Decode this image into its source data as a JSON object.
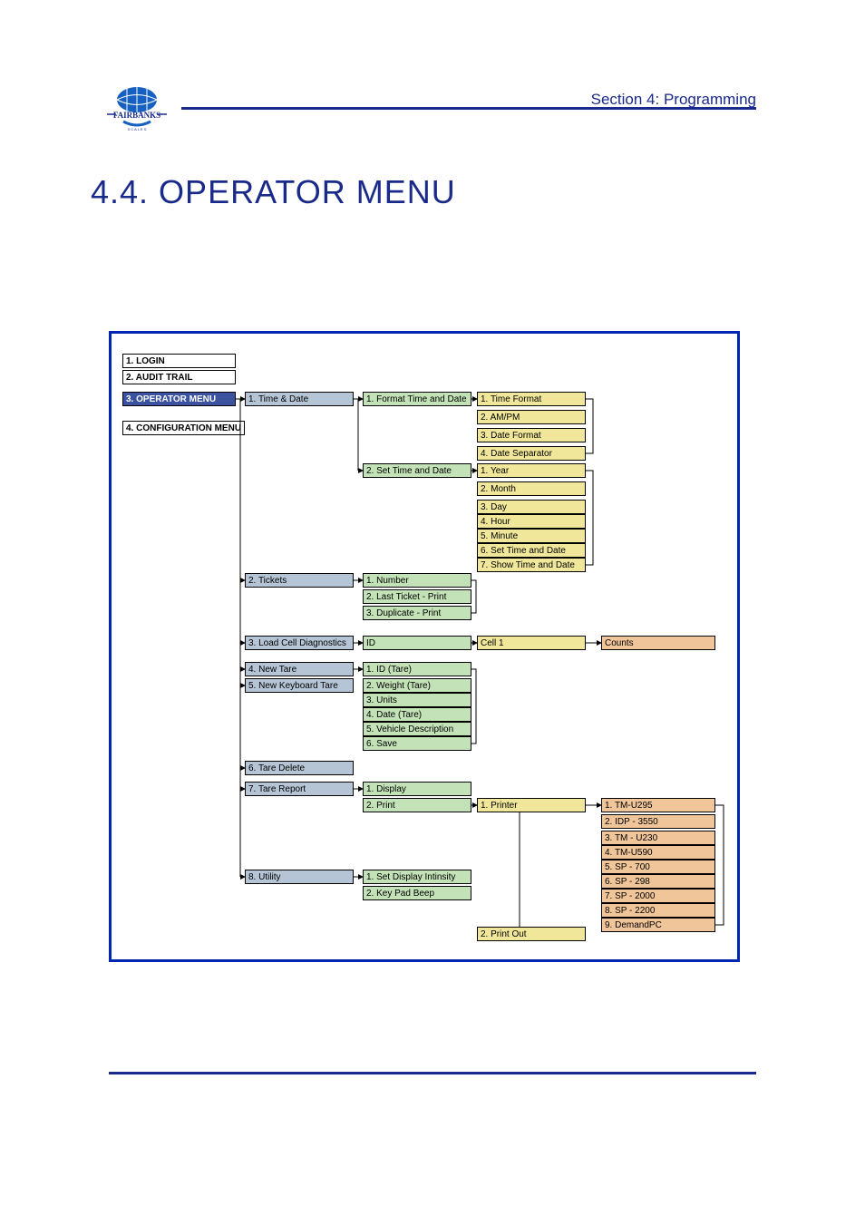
{
  "header": {
    "section_label": "Section 4: Programming",
    "logo_text": "FAIRBANKS",
    "title": "4.4.   OPERATOR MENU"
  },
  "menu": {
    "level1": [
      {
        "label": "1. LOGIN",
        "bold": true
      },
      {
        "label": "2. AUDIT TRAIL",
        "bold": true
      },
      {
        "label": "3. OPERATOR MENU",
        "highlight": true
      },
      {
        "label": "4. CONFIGURATION MENU",
        "bold": true
      }
    ],
    "operator_children": [
      {
        "label": "1. Time & Date"
      },
      {
        "label": "2. Tickets"
      },
      {
        "label": "3. Load Cell Diagnostics"
      },
      {
        "label": "4. New Tare"
      },
      {
        "label": "5. New Keyboard Tare"
      },
      {
        "label": "6. Tare Delete"
      },
      {
        "label": "7. Tare Report"
      },
      {
        "label": "8. Utility"
      }
    ],
    "time_date_children": [
      {
        "label": "1. Format Time and Date"
      },
      {
        "label": "2. Set Time and Date"
      }
    ],
    "format_td_children": [
      {
        "label": "1. Time Format"
      },
      {
        "label": "2. AM/PM"
      },
      {
        "label": "3. Date Format"
      },
      {
        "label": "4. Date Separator"
      }
    ],
    "set_td_children": [
      {
        "label": "1. Year"
      },
      {
        "label": "2. Month"
      },
      {
        "label": "3. Day"
      },
      {
        "label": "4. Hour"
      },
      {
        "label": "5. Minute"
      },
      {
        "label": "6. Set Time and Date"
      },
      {
        "label": "7. Show Time and Date"
      }
    ],
    "tickets_children": [
      {
        "label": "1. Number"
      },
      {
        "label": "2. Last Ticket - Print"
      },
      {
        "label": "3. Duplicate - Print"
      }
    ],
    "lcd_children": {
      "id": "ID",
      "cell": "Cell 1",
      "counts": "Counts"
    },
    "new_tare_children": [
      {
        "label": "1. ID (Tare)"
      },
      {
        "label": "2. Weight (Tare)"
      },
      {
        "label": "3. Units"
      },
      {
        "label": "4. Date (Tare)"
      },
      {
        "label": "5. Vehicle Description"
      },
      {
        "label": "6. Save"
      }
    ],
    "tare_report_children": [
      {
        "label": "1. Display"
      },
      {
        "label": "2. Print"
      }
    ],
    "print_children": [
      {
        "label": "1. Printer"
      },
      {
        "label": "2. Print Out"
      }
    ],
    "printer_models": [
      {
        "label": "1. TM-U295"
      },
      {
        "label": "2. IDP - 3550"
      },
      {
        "label": "3. TM - U230"
      },
      {
        "label": "4. TM-U590"
      },
      {
        "label": "5. SP - 700"
      },
      {
        "label": "6. SP - 298"
      },
      {
        "label": "7. SP - 2000"
      },
      {
        "label": "8. SP - 2200"
      },
      {
        "label": "9. DemandPC"
      }
    ],
    "utility_children": [
      {
        "label": "1. Set Display Intinsity"
      },
      {
        "label": "2. Key Pad Beep"
      }
    ]
  },
  "chart_data": {
    "type": "tree",
    "title": "Operator Menu structure",
    "root": "3. OPERATOR MENU",
    "siblings": [
      "1. LOGIN",
      "2. AUDIT TRAIL",
      "4. CONFIGURATION MENU"
    ],
    "children": [
      {
        "name": "1. Time & Date",
        "children": [
          {
            "name": "1. Format Time and Date",
            "children": [
              {
                "name": "1. Time Format"
              },
              {
                "name": "2. AM/PM"
              },
              {
                "name": "3. Date Format"
              },
              {
                "name": "4. Date Separator"
              }
            ]
          },
          {
            "name": "2. Set Time and Date",
            "children": [
              {
                "name": "1. Year"
              },
              {
                "name": "2. Month"
              },
              {
                "name": "3. Day"
              },
              {
                "name": "4. Hour"
              },
              {
                "name": "5. Minute"
              },
              {
                "name": "6. Set Time and Date"
              },
              {
                "name": "7. Show Time and Date"
              }
            ]
          }
        ]
      },
      {
        "name": "2. Tickets",
        "children": [
          {
            "name": "1. Number"
          },
          {
            "name": "2. Last Ticket - Print"
          },
          {
            "name": "3. Duplicate - Print"
          }
        ]
      },
      {
        "name": "3. Load Cell Diagnostics",
        "children": [
          {
            "name": "ID",
            "children": [
              {
                "name": "Cell 1",
                "children": [
                  {
                    "name": "Counts"
                  }
                ]
              }
            ]
          }
        ]
      },
      {
        "name": "4. New Tare",
        "children": [
          {
            "name": "1. ID (Tare)"
          },
          {
            "name": "2. Weight (Tare)"
          },
          {
            "name": "3. Units"
          },
          {
            "name": "4. Date (Tare)"
          },
          {
            "name": "5. Vehicle Description"
          },
          {
            "name": "6. Save"
          }
        ]
      },
      {
        "name": "5. New Keyboard Tare"
      },
      {
        "name": "6. Tare Delete"
      },
      {
        "name": "7. Tare Report",
        "children": [
          {
            "name": "1. Display"
          },
          {
            "name": "2. Print",
            "children": [
              {
                "name": "1. Printer",
                "children": [
                  {
                    "name": "1. TM-U295"
                  },
                  {
                    "name": "2. IDP - 3550"
                  },
                  {
                    "name": "3. TM - U230"
                  },
                  {
                    "name": "4. TM-U590"
                  },
                  {
                    "name": "5. SP - 700"
                  },
                  {
                    "name": "6. SP - 298"
                  },
                  {
                    "name": "7. SP - 2000"
                  },
                  {
                    "name": "8. SP - 2200"
                  },
                  {
                    "name": "9. DemandPC"
                  }
                ]
              },
              {
                "name": "2. Print Out"
              }
            ]
          }
        ]
      },
      {
        "name": "8. Utility",
        "children": [
          {
            "name": "1. Set Display Intinsity"
          },
          {
            "name": "2. Key Pad Beep"
          }
        ]
      }
    ]
  }
}
